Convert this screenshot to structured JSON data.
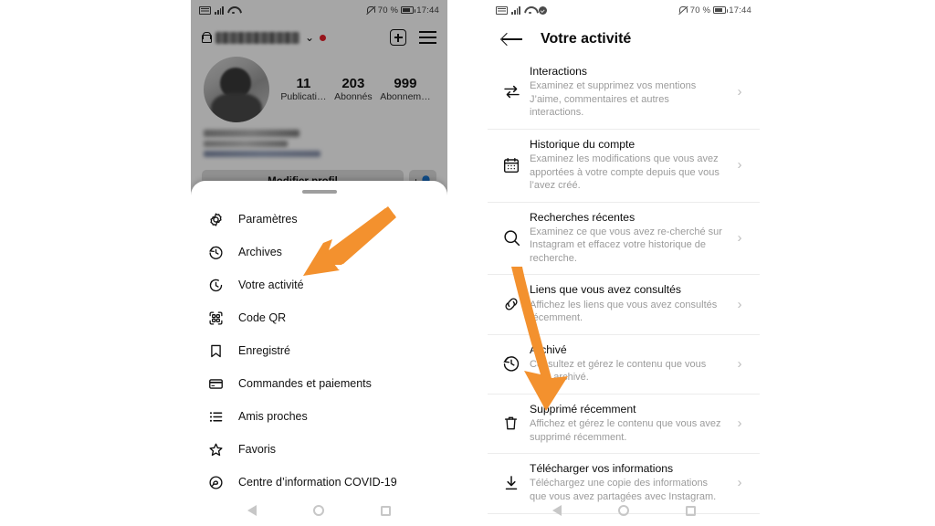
{
  "meta": {
    "accent_orange": "#F3912E",
    "background": "#FFFFFF"
  },
  "left_phone": {
    "status_bar": {
      "icons_left": [
        "sim-card-icon",
        "signal-bars-icon",
        "wifi-icon"
      ],
      "notification_silent": "bell-off-icon",
      "battery_percent": "70 %",
      "battery_icon": "battery-icon",
      "time": "17:44"
    },
    "profile": {
      "lock_icon": "lock-icon",
      "username_blurred": "",
      "chevron": "⌄",
      "has_unread_dot": true,
      "add_button": "plus-box-icon",
      "menu_button": "hamburger-icon",
      "stats": [
        {
          "value": "11",
          "label": "Publicati…"
        },
        {
          "value": "203",
          "label": "Abonnés"
        },
        {
          "value": "999",
          "label": "Abonnem…"
        }
      ],
      "edit_profile_label": "Modifier profil",
      "add_person_icon": "add-person-icon"
    },
    "bottom_sheet": {
      "handle": "drag-handle",
      "items": [
        {
          "icon": "settings-gear-icon",
          "label": "Paramètres"
        },
        {
          "icon": "archive-clock-icon",
          "label": "Archives"
        },
        {
          "icon": "activity-clock-icon",
          "label": "Votre activité"
        },
        {
          "icon": "qr-code-icon",
          "label": "Code QR"
        },
        {
          "icon": "bookmark-icon",
          "label": "Enregistré"
        },
        {
          "icon": "credit-card-icon",
          "label": "Commandes et paiements"
        },
        {
          "icon": "close-friends-list-icon",
          "label": "Amis proches"
        },
        {
          "icon": "star-icon",
          "label": "Favoris"
        },
        {
          "icon": "covid-info-icon",
          "label": "Centre d’information COVID-19"
        }
      ]
    },
    "nav_bar": [
      "nav-back-icon",
      "nav-home-icon",
      "nav-recents-icon"
    ]
  },
  "right_phone": {
    "status_bar": {
      "icons_left": [
        "sim-card-icon",
        "signal-bars-icon",
        "wifi-icon",
        "check-circle-icon"
      ],
      "notification_silent": "bell-off-icon",
      "battery_percent": "70 %",
      "battery_icon": "battery-icon",
      "time": "17:44"
    },
    "header": {
      "back_icon": "back-arrow-icon",
      "title": "Votre activité"
    },
    "items": [
      {
        "icon": "interactions-arrows-icon",
        "title": "Interactions",
        "description": "Examinez et supprimez vos mentions J’aime, commentaires et autres interactions.",
        "chevron": "›"
      },
      {
        "icon": "calendar-icon",
        "title": "Historique du compte",
        "description": "Examinez les modifications que vous avez apportées à votre compte depuis que vous l’avez créé.",
        "chevron": "›"
      },
      {
        "icon": "search-icon",
        "title": "Recherches récentes",
        "description": "Examinez ce que vous avez re-cherché sur Instagram et effacez votre historique de recherche.",
        "chevron": "›"
      },
      {
        "icon": "link-icon",
        "title": "Liens que vous avez consultés",
        "description": "Affichez les liens que vous avez consultés récemment.",
        "chevron": "›"
      },
      {
        "icon": "archive-clock-icon",
        "title": "Archivé",
        "description": "Consultez et gérez le contenu que vous avez archivé.",
        "chevron": "›"
      },
      {
        "icon": "trash-icon",
        "title": "Supprimé récemment",
        "description": "Affichez et gérez le contenu que vous avez supprimé récemment.",
        "chevron": "›"
      },
      {
        "icon": "download-icon",
        "title": "Télécharger vos informations",
        "description": "Téléchargez une copie des informations que vous avez partagées avec Instagram.",
        "chevron": "›"
      }
    ],
    "nav_bar": [
      "nav-back-icon",
      "nav-home-icon",
      "nav-recents-icon"
    ]
  },
  "annotations": [
    {
      "name": "arrow-pointing-votre-activite",
      "color": "#F3912E",
      "direction": "down-left"
    },
    {
      "name": "arrow-pointing-telecharger-vos-informations",
      "color": "#F3912E",
      "direction": "down-right"
    }
  ]
}
